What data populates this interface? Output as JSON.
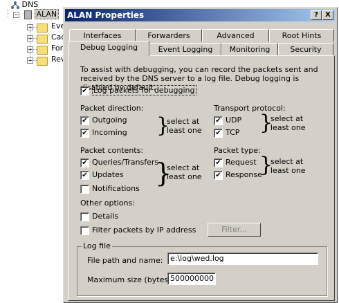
{
  "tree": {
    "root": "DNS",
    "server": "ALAN",
    "children": [
      "Eve",
      "Cac",
      "For",
      "Rev"
    ]
  },
  "dialog": {
    "title": "ALAN Properties",
    "help_btn": "?",
    "close_btn": "X",
    "tabs_back": [
      "Interfaces",
      "Forwarders",
      "Advanced",
      "Root Hints"
    ],
    "tabs_front": [
      "Debug Logging",
      "Event Logging",
      "Monitoring",
      "Security"
    ],
    "intro": "To assist with debugging, you can record the packets sent and received by the DNS server to a log file. Debug logging is disabled by default.",
    "log_packets": "Log packets for debugging",
    "direction": {
      "title": "Packet direction:",
      "outgoing": "Outgoing",
      "incoming": "Incoming",
      "hint": "select at least one"
    },
    "transport": {
      "title": "Transport protocol:",
      "udp": "UDP",
      "tcp": "TCP",
      "hint": "select at least one"
    },
    "contents": {
      "title": "Packet contents:",
      "queries": "Queries/Transfers",
      "updates": "Updates",
      "notifications": "Notifications",
      "hint": "select at least one"
    },
    "ptype": {
      "title": "Packet type:",
      "request": "Request",
      "response": "Response",
      "hint": "select at least one"
    },
    "other": {
      "title": "Other options:",
      "details": "Details",
      "filter": "Filter packets by IP address",
      "filter_btn": "Filter..."
    },
    "logfile": {
      "title": "Log file",
      "path_label": "File path and name:",
      "path_value": "e:\\log\\wed.log",
      "size_label": "Maximum size (bytes):",
      "size_value": "500000000"
    },
    "checked_mark": "✔"
  }
}
